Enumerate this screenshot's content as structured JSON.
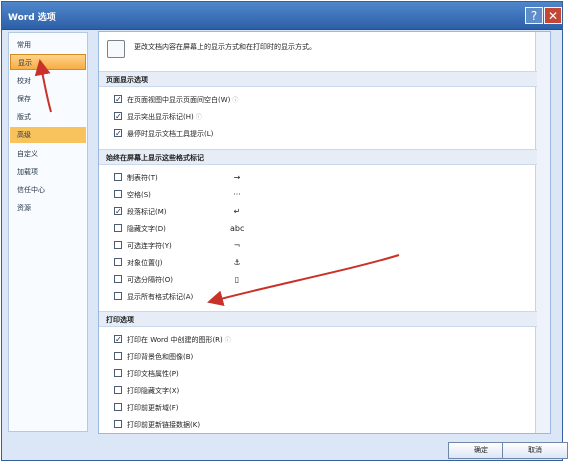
{
  "window": {
    "title": "Word 选项",
    "help": "?",
    "close": "✕"
  },
  "sidebar": {
    "items": [
      "常用",
      "显示",
      "校对",
      "保存",
      "版式",
      "高级",
      "自定义",
      "加载项",
      "信任中心",
      "资源"
    ]
  },
  "intro": "更改文档内容在屏幕上的显示方式和在打印时的显示方式。",
  "sections": {
    "page": "页面显示选项",
    "marks": "始终在屏幕上显示这些格式标记",
    "print": "打印选项"
  },
  "page_options": [
    {
      "label": "在页面视图中显示页面间空白(W)",
      "checked": true,
      "info": "ⓘ"
    },
    {
      "label": "显示突出显示标记(H)",
      "checked": true,
      "info": "ⓘ"
    },
    {
      "label": "悬停时显示文档工具提示(L)",
      "checked": true,
      "info": ""
    }
  ],
  "mark_options": [
    {
      "label": "制表符(T)",
      "checked": false,
      "symbol": "→"
    },
    {
      "label": "空格(S)",
      "checked": false,
      "symbol": "···"
    },
    {
      "label": "段落标记(M)",
      "checked": true,
      "symbol": "↵"
    },
    {
      "label": "隐藏文字(D)",
      "checked": false,
      "symbol": "abc"
    },
    {
      "label": "可选连字符(Y)",
      "checked": false,
      "symbol": "¬"
    },
    {
      "label": "对象位置(J)",
      "checked": false,
      "symbol": "⚓"
    },
    {
      "label": "可选分隔符(O)",
      "checked": false,
      "symbol": "▯"
    },
    {
      "label": "显示所有格式标记(A)",
      "checked": false,
      "symbol": ""
    }
  ],
  "print_options": [
    {
      "label": "打印在 Word 中创建的图形(R)",
      "checked": true,
      "info": "ⓘ"
    },
    {
      "label": "打印背景色和图像(B)",
      "checked": false,
      "info": ""
    },
    {
      "label": "打印文档属性(P)",
      "checked": false,
      "info": ""
    },
    {
      "label": "打印隐藏文字(X)",
      "checked": false,
      "info": ""
    },
    {
      "label": "打印前更新域(F)",
      "checked": false,
      "info": ""
    },
    {
      "label": "打印前更新链接数据(K)",
      "checked": false,
      "info": ""
    }
  ],
  "buttons": {
    "ok": "确定",
    "cancel": "取消"
  }
}
